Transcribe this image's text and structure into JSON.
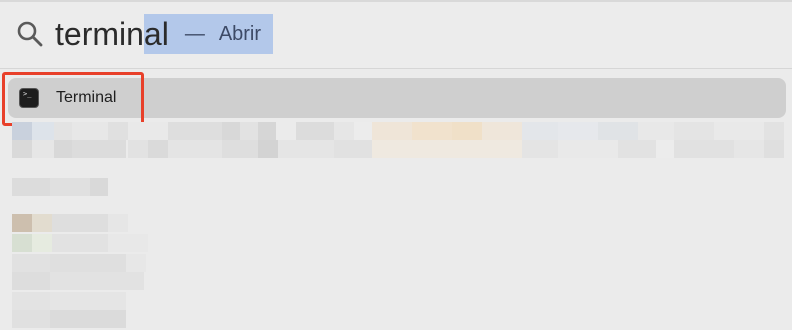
{
  "search": {
    "typed_text": "termin",
    "completed_text": "al",
    "separator": "—",
    "action_hint": "Abrir"
  },
  "results": [
    {
      "label": "Terminal",
      "icon": "terminal-app-icon",
      "selected": true
    }
  ],
  "colors": {
    "selection_highlight": "#b3c8ea",
    "annotation_box": "#e8402a",
    "row_selected": "#cfcfcf",
    "accent": "#3c7be0"
  }
}
